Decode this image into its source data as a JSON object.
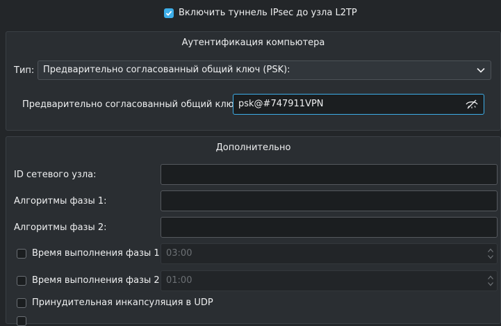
{
  "ipsec_enable": {
    "label": "Включить туннель IPsec до узла L2TP",
    "checked": true
  },
  "auth": {
    "title": "Аутентификация компьютера",
    "type_label": "Тип:",
    "type_value": "Предварительно согласованный общий ключ (PSK):",
    "psk_label": "Предварительно согласованный общий ключ:",
    "psk_value": "psk@#747911VPN"
  },
  "advanced": {
    "title": "Дополнительно",
    "peer_id_label": "ID сетевого узла:",
    "peer_id_value": "",
    "phase1_alg_label": "Алгоритмы фазы 1:",
    "phase1_alg_value": "",
    "phase2_alg_label": "Алгоритмы фазы 2:",
    "phase2_alg_value": "",
    "phase1_lifetime": {
      "label": "Время выполнения фазы 1:",
      "value": "03:00",
      "checked": false
    },
    "phase2_lifetime": {
      "label": "Время выполнения фазы 2:",
      "value": "01:00",
      "checked": false
    },
    "force_udp": {
      "label": "Принудительная инкапсуляция в UDP",
      "checked": false
    }
  },
  "colors": {
    "accent": "#3daee9",
    "background": "#232629",
    "panel": "#2a2e32"
  },
  "icons": {
    "psk_visibility": "eye-off-icon",
    "combo_arrow": "chevron-down-icon",
    "spin": "spin-arrows-icon"
  }
}
